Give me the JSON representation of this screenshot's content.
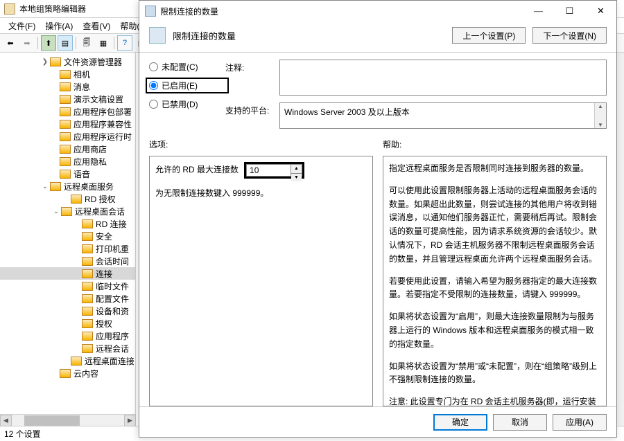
{
  "bg": {
    "title": "本地组策略编辑器",
    "menu": [
      "文件(F)",
      "操作(A)",
      "查看(V)",
      "帮助("
    ],
    "status": "12 个设置",
    "tree": [
      {
        "ind": 58,
        "tw": ">",
        "label": "文件资源管理器"
      },
      {
        "ind": 72,
        "tw": "",
        "label": "相机"
      },
      {
        "ind": 72,
        "tw": "",
        "label": "消息"
      },
      {
        "ind": 72,
        "tw": "",
        "label": "演示文稿设置"
      },
      {
        "ind": 72,
        "tw": "",
        "label": "应用程序包部署"
      },
      {
        "ind": 72,
        "tw": "",
        "label": "应用程序兼容性"
      },
      {
        "ind": 72,
        "tw": "",
        "label": "应用程序运行时"
      },
      {
        "ind": 72,
        "tw": "",
        "label": "应用商店"
      },
      {
        "ind": 72,
        "tw": "",
        "label": "应用隐私"
      },
      {
        "ind": 72,
        "tw": "",
        "label": "语音"
      },
      {
        "ind": 58,
        "tw": "v",
        "label": "远程桌面服务"
      },
      {
        "ind": 88,
        "tw": "",
        "label": "RD 授权"
      },
      {
        "ind": 74,
        "tw": "v",
        "label": "远程桌面会话"
      },
      {
        "ind": 104,
        "tw": "",
        "label": "RD 连接"
      },
      {
        "ind": 104,
        "tw": "",
        "label": "安全"
      },
      {
        "ind": 104,
        "tw": "",
        "label": "打印机重"
      },
      {
        "ind": 104,
        "tw": "",
        "label": "会话时间"
      },
      {
        "ind": 104,
        "tw": "",
        "label": "连接",
        "sel": true
      },
      {
        "ind": 104,
        "tw": "",
        "label": "临时文件"
      },
      {
        "ind": 104,
        "tw": "",
        "label": "配置文件"
      },
      {
        "ind": 104,
        "tw": "",
        "label": "设备和资"
      },
      {
        "ind": 104,
        "tw": "",
        "label": "授权"
      },
      {
        "ind": 104,
        "tw": "",
        "label": "应用程序"
      },
      {
        "ind": 104,
        "tw": "",
        "label": "远程会话"
      },
      {
        "ind": 88,
        "tw": "",
        "label": "远程桌面连接"
      },
      {
        "ind": 72,
        "tw": "",
        "label": "云内容"
      }
    ]
  },
  "dlg": {
    "title": "限制连接的数量",
    "header_title": "限制连接的数量",
    "prev_btn": "上一个设置(P)",
    "next_btn": "下一个设置(N)",
    "radio_unconf": "未配置(C)",
    "radio_enabled": "已启用(E)",
    "radio_disabled": "已禁用(D)",
    "comment_label": "注释:",
    "comment_value": "",
    "platform_label": "支持的平台:",
    "platform_value": "Windows Server 2003 及以上版本",
    "options_label": "选项:",
    "help_label": "帮助:",
    "opt_maxconn_label": "允许的 RD 最大连接数",
    "opt_maxconn_value": "10",
    "opt_note": "为无限制连接数键入 999999。",
    "help_paragraphs": [
      "指定远程桌面服务是否限制同时连接到服务器的数量。",
      "可以使用此设置限制服务器上活动的远程桌面服务会话的数量。如果超出此数量，则尝试连接的其他用户将收到错误消息，以通知他们服务器正忙，需要稍后再试。限制会话的数量可提高性能，因为请求系统资源的会话较少。默认情况下，RD 会话主机服务器不限制远程桌面服务会话的数量，并且管理远程桌面允许两个远程桌面服务会话。",
      "若要使用此设置，请输入希望为服务器指定的最大连接数量。若要指定不受限制的连接数量，请键入 999999。",
      "如果将状态设置为“启用”，则最大连接数量限制为与服务器上运行的 Windows 版本和远程桌面服务的模式相一致的指定数量。",
      "如果将状态设置为“禁用”或“未配置”，则在“组策略”级别上不强制限制连接的数量。",
      "注意: 此设置专门为在 RD 会话主机服务器(即，运行安装有远程桌面会话主机角色服务的 Windows 的服务器)上使用而设计。"
    ],
    "btn_ok": "确定",
    "btn_cancel": "取消",
    "btn_apply": "应用(A)"
  }
}
